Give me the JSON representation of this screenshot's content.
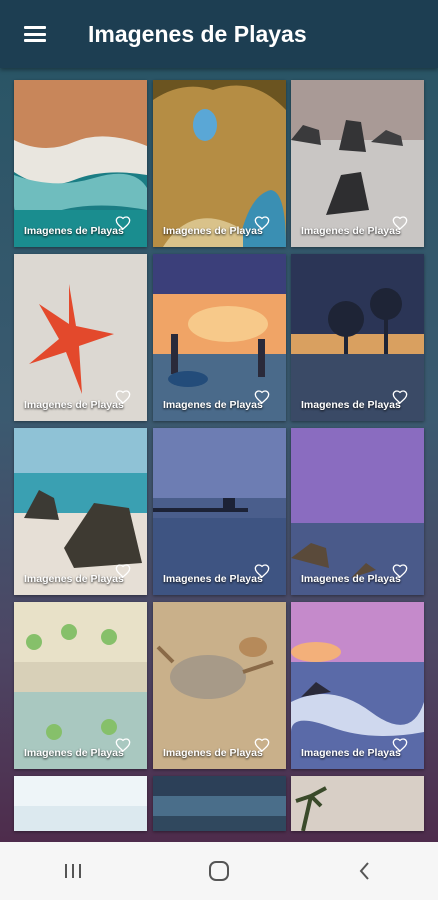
{
  "app": {
    "title": "Imagenes de Playas"
  },
  "grid": {
    "tiles": [
      {
        "caption": "Imagenes de Playas",
        "art": "aerial-shore"
      },
      {
        "caption": "Imagenes de Playas",
        "art": "sea-cave"
      },
      {
        "caption": "Imagenes de Playas",
        "art": "misty-rocks"
      },
      {
        "caption": "Imagenes de Playas",
        "art": "starfish"
      },
      {
        "caption": "Imagenes de Playas",
        "art": "fishermen-sunset"
      },
      {
        "caption": "Imagenes de Playas",
        "art": "tree-sunset"
      },
      {
        "caption": "Imagenes de Playas",
        "art": "beach-boulders"
      },
      {
        "caption": "Imagenes de Playas",
        "art": "pier-dusk"
      },
      {
        "caption": "Imagenes de Playas",
        "art": "purple-sea"
      },
      {
        "caption": "Imagenes de Playas",
        "art": "beach-umbrellas"
      },
      {
        "caption": "Imagenes de Playas",
        "art": "crab-sand"
      },
      {
        "caption": "Imagenes de Playas",
        "art": "pink-waves"
      },
      {
        "caption": "",
        "art": "pale-sky"
      },
      {
        "caption": "",
        "art": "storm-clouds"
      },
      {
        "caption": "",
        "art": "palm-tree"
      }
    ]
  },
  "navbar": {
    "icons": [
      "recents-icon",
      "home-icon",
      "back-icon"
    ]
  }
}
